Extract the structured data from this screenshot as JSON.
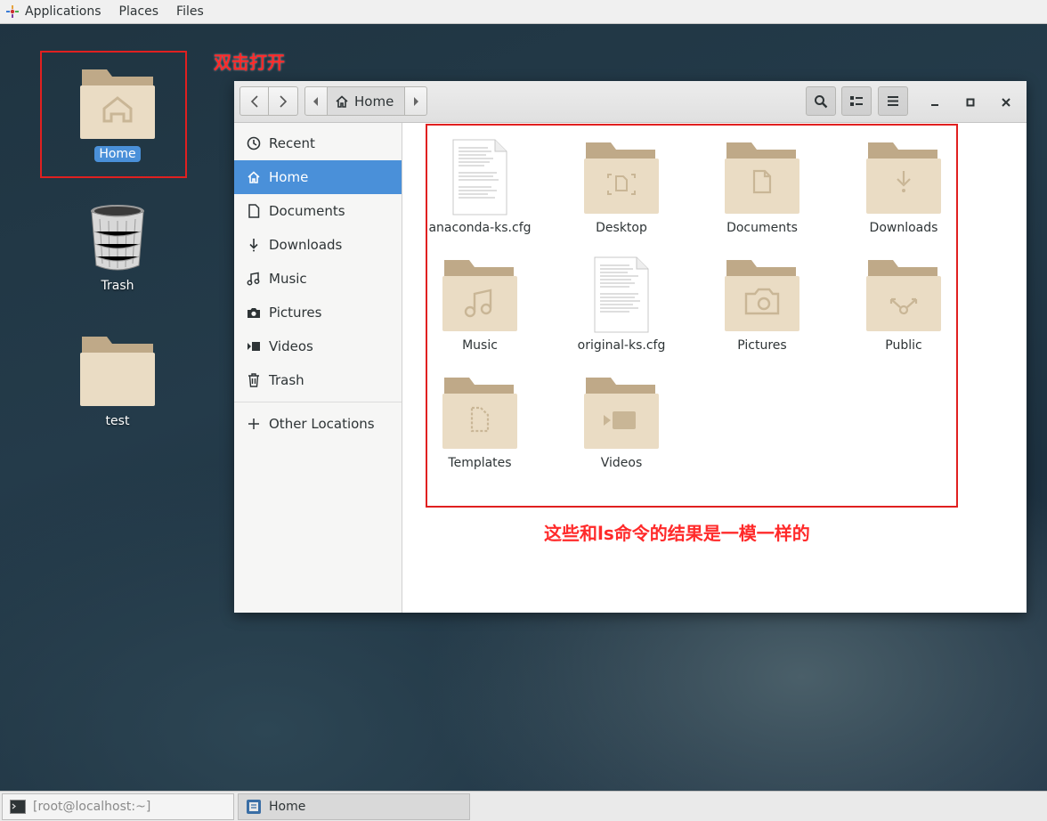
{
  "topbar": {
    "applications": "Applications",
    "places": "Places",
    "files": "Files"
  },
  "desktop": {
    "icons": [
      {
        "label": "Home",
        "icon": "home-folder-icon"
      },
      {
        "label": "Trash",
        "icon": "trash-can-icon"
      },
      {
        "label": "test",
        "icon": "folder-icon"
      }
    ]
  },
  "annotations": {
    "double_click": "双击打开",
    "same_as_ls": "这些和ls命令的结果是一模一样的",
    "color": "#e02020"
  },
  "window": {
    "path": {
      "current": "Home"
    },
    "sidebar": [
      {
        "label": "Recent",
        "icon": "clock-icon"
      },
      {
        "label": "Home",
        "icon": "home-icon",
        "selected": true
      },
      {
        "label": "Documents",
        "icon": "document-icon"
      },
      {
        "label": "Downloads",
        "icon": "download-icon"
      },
      {
        "label": "Music",
        "icon": "music-icon"
      },
      {
        "label": "Pictures",
        "icon": "camera-icon"
      },
      {
        "label": "Videos",
        "icon": "video-icon"
      },
      {
        "label": "Trash",
        "icon": "trash-icon"
      },
      {
        "label": "Other Locations",
        "icon": "plus-icon"
      }
    ],
    "files": [
      {
        "name": "anaconda-ks.cfg",
        "type": "text-file"
      },
      {
        "name": "Desktop",
        "type": "folder"
      },
      {
        "name": "Documents",
        "type": "folder"
      },
      {
        "name": "Downloads",
        "type": "folder"
      },
      {
        "name": "Music",
        "type": "folder"
      },
      {
        "name": "original-ks.cfg",
        "type": "text-file"
      },
      {
        "name": "Pictures",
        "type": "folder"
      },
      {
        "name": "Public",
        "type": "folder"
      },
      {
        "name": "Templates",
        "type": "folder"
      },
      {
        "name": "Videos",
        "type": "folder"
      }
    ],
    "selected_color": "#4a90d9"
  },
  "taskbar": {
    "items": [
      {
        "label": "[root@localhost:~]",
        "icon": "terminal-icon"
      },
      {
        "label": "Home",
        "icon": "file-manager-icon",
        "active": true
      }
    ]
  }
}
